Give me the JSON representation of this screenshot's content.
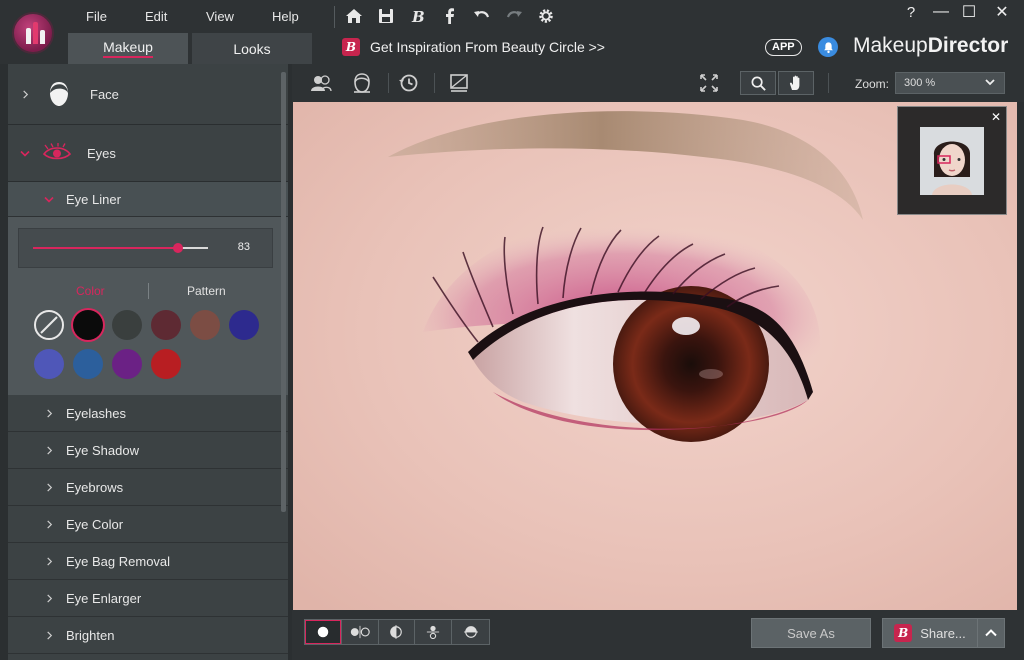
{
  "menu": {
    "file": "File",
    "edit": "Edit",
    "view": "View",
    "help": "Help"
  },
  "window": {
    "help_btn": "?",
    "minimize_btn": "—",
    "maximize_btn": "☐",
    "close_btn": "✕"
  },
  "tabs": [
    {
      "label": "Makeup"
    },
    {
      "label": "Looks"
    }
  ],
  "inspiration": {
    "badge": "B",
    "text": "Get Inspiration From Beauty Circle >>"
  },
  "header": {
    "app_badge": "APP",
    "brand_prefix": "Makeup",
    "brand_suffix": "Director"
  },
  "sidebar": {
    "face": {
      "label": "Face"
    },
    "eyes": {
      "label": "Eyes"
    },
    "eye_liner": {
      "label": "Eye Liner",
      "slider_value": "83",
      "slider_fraction": 0.83,
      "option_color": "Color",
      "option_pattern": "Pattern",
      "swatches": [
        {
          "name": "none",
          "color": "transparent"
        },
        {
          "name": "black",
          "color": "#0b0b0b"
        },
        {
          "name": "charcoal",
          "color": "#3a3f3e"
        },
        {
          "name": "plum-brown",
          "color": "#5e2a33"
        },
        {
          "name": "cocoa",
          "color": "#7c4d44"
        },
        {
          "name": "indigo",
          "color": "#2d2a8e"
        },
        {
          "name": "periwinkle",
          "color": "#4f57b8"
        },
        {
          "name": "steel-blue",
          "color": "#2c5f9c"
        },
        {
          "name": "purple",
          "color": "#6b2185"
        },
        {
          "name": "red",
          "color": "#b81e22"
        }
      ]
    },
    "items": [
      {
        "label": "Eyelashes"
      },
      {
        "label": "Eye Shadow"
      },
      {
        "label": "Eyebrows"
      },
      {
        "label": "Eye Color"
      },
      {
        "label": "Eye Bag Removal"
      },
      {
        "label": "Eye Enlarger"
      },
      {
        "label": "Brighten"
      }
    ]
  },
  "viewer": {
    "zoom_label": "Zoom:",
    "zoom_value": "300 %",
    "thumb_close": "✕"
  },
  "footer": {
    "save_as": "Save As",
    "share": "Share..."
  },
  "colors": {
    "accent": "#d8265d",
    "brand_badge": "#c7254e",
    "notification": "#3a8ce0"
  }
}
